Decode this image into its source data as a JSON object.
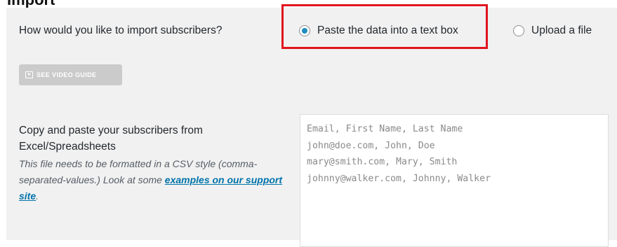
{
  "page": {
    "cutoff_heading": "Import"
  },
  "import": {
    "question": "How would you like to import subscribers?",
    "options": [
      {
        "label": "Paste the data into a text box",
        "checked": true
      },
      {
        "label": "Upload a file",
        "checked": false
      }
    ],
    "highlight_color": "#e0141e"
  },
  "video_guide": {
    "label": "SEE VIDEO GUIDE",
    "icon": "play-icon"
  },
  "copy_paste": {
    "title": "Copy and paste your subscribers from Excel/Spreadsheets",
    "description_prefix": "This file needs to be formatted in a CSV style (comma-separated-values.) Look at some ",
    "link_text": "examples on our support site",
    "description_suffix": "."
  },
  "textarea": {
    "placeholder": "Email, First Name, Last Name\njohn@doe.com, John, Doe\nmary@smith.com, Mary, Smith\njohnny@walker.com, Johnny, Walker",
    "value": ""
  },
  "colors": {
    "panel_bg": "#f1f1f1",
    "link": "#0073aa",
    "radio_dot": "#1e8cbe",
    "button_bg": "#cbcbcb"
  }
}
